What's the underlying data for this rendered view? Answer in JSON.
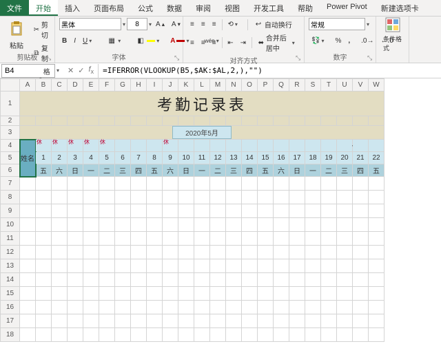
{
  "tabs": {
    "file": "文件",
    "home": "开始",
    "insert": "插入",
    "layout": "页面布局",
    "formulas": "公式",
    "data": "数据",
    "review": "审阅",
    "view": "视图",
    "dev": "开发工具",
    "help": "帮助",
    "powerpivot": "Power Pivot",
    "newtab": "新建选项卡"
  },
  "ribbon": {
    "clipboard": {
      "label": "剪贴板",
      "paste": "粘贴",
      "cut": "剪切",
      "copy": "复制",
      "painter": "格式刷"
    },
    "font": {
      "label": "字体",
      "name": "黑体",
      "size": "8"
    },
    "align": {
      "label": "对齐方式",
      "wrap": "自动换行",
      "merge": "合并后居中"
    },
    "number": {
      "label": "数字",
      "format": "常规"
    },
    "styles": {
      "cond": "条件格式"
    }
  },
  "fbar": {
    "namebox": "B4",
    "formula": "=IFERROR(VLOOKUP(B5,$AK:$AL,2,),\"\")"
  },
  "sheet": {
    "title": "考勤记录表",
    "date": "2020年5月",
    "name_header": "姓名",
    "rest": "休",
    "cols": [
      "A",
      "B",
      "C",
      "D",
      "E",
      "F",
      "G",
      "H",
      "I",
      "J",
      "K",
      "L",
      "M",
      "N",
      "O",
      "P",
      "Q",
      "R",
      "S",
      "T",
      "U",
      "V",
      "W"
    ],
    "rows": [
      "1",
      "2",
      "3",
      "4",
      "5",
      "6",
      "7",
      "8",
      "9",
      "10",
      "11",
      "12",
      "13",
      "14",
      "15",
      "16",
      "17",
      "18"
    ],
    "days": [
      "1",
      "2",
      "3",
      "4",
      "5",
      "6",
      "7",
      "8",
      "9",
      "10",
      "11",
      "12",
      "13",
      "14",
      "15",
      "16",
      "17",
      "18",
      "19",
      "20",
      "21",
      "22"
    ],
    "weekdays": [
      "五",
      "六",
      "日",
      "一",
      "二",
      "三",
      "四",
      "五",
      "六",
      "日",
      "一",
      "二",
      "三",
      "四",
      "五",
      "六",
      "日",
      "一",
      "二",
      "三",
      "四",
      "五"
    ],
    "rest_idx": [
      0,
      1,
      2,
      3,
      4,
      8
    ]
  }
}
